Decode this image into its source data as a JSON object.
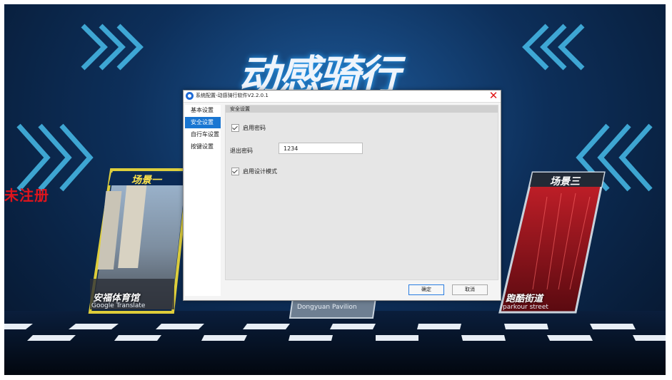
{
  "background": {
    "banner_text": "动感骑行",
    "unregistered_label": "未注册",
    "cards": [
      {
        "title": "场景一",
        "name": "安福体育馆",
        "sub": "Google Translate"
      },
      {
        "title": "",
        "name": "",
        "sub": "Dongyuan Pavilion"
      },
      {
        "title": "场景三",
        "name": "跑酷街道",
        "sub": "parkour street"
      }
    ]
  },
  "dialog": {
    "title": "系统配置-动感骑行软件V2.2.0.1",
    "close_icon": "close-icon",
    "sidebar": {
      "items": [
        {
          "label": "基本设置",
          "active": false
        },
        {
          "label": "安全设置",
          "active": true
        },
        {
          "label": "自行车设置",
          "active": false
        },
        {
          "label": "按键设置",
          "active": false
        }
      ]
    },
    "section_title": "安全设置",
    "enable_password": {
      "label": "启用密码",
      "checked": true
    },
    "exit_password": {
      "label": "退出密码",
      "value": "1234"
    },
    "design_mode": {
      "label": "启用设计模式",
      "checked": true
    },
    "ok_label": "确定",
    "cancel_label": "取消"
  },
  "colors": {
    "accent": "#1976d2",
    "close": "#e01818",
    "unregistered": "#e0141c"
  }
}
